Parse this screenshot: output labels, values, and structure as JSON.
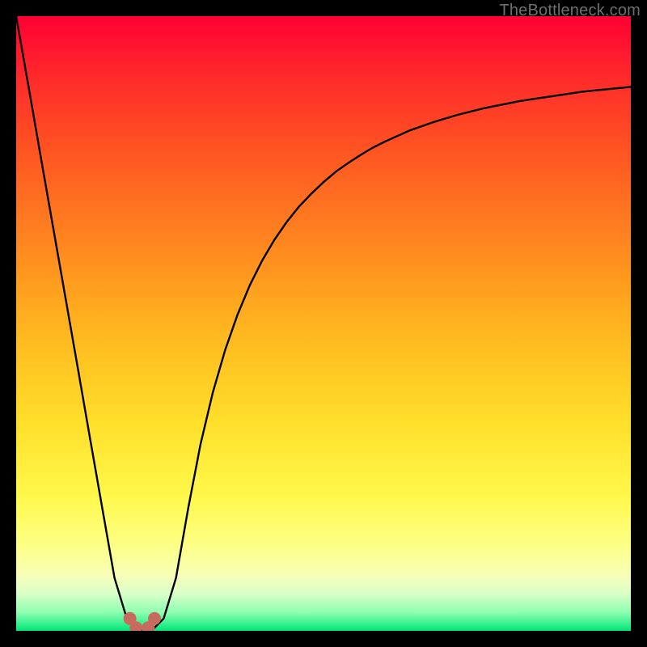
{
  "watermark": "TheBottleneck.com",
  "chart_data": {
    "type": "line",
    "title": "",
    "xlabel": "",
    "ylabel": "",
    "xlim": [
      0,
      100
    ],
    "ylim": [
      0,
      100
    ],
    "grid": false,
    "x": [
      0,
      2,
      4,
      6,
      8,
      10,
      12,
      14,
      16,
      18,
      20,
      22,
      24,
      26,
      28,
      30,
      32,
      34,
      36,
      38,
      40,
      42,
      44,
      46,
      48,
      50,
      52,
      54,
      56,
      58,
      60,
      62,
      64,
      66,
      68,
      70,
      72,
      74,
      76,
      78,
      80,
      82,
      84,
      86,
      88,
      90,
      92,
      94,
      96,
      98,
      100
    ],
    "series": [
      {
        "name": "bottleneck-curve",
        "values": [
          100,
          88.6,
          77.1,
          65.7,
          54.3,
          42.9,
          31.4,
          20,
          8.6,
          2,
          0,
          0,
          2,
          8.6,
          20,
          30.4,
          38.8,
          45.7,
          51.4,
          56.2,
          60.2,
          63.6,
          66.5,
          69,
          71.1,
          73,
          74.7,
          76.1,
          77.4,
          78.6,
          79.6,
          80.5,
          81.4,
          82.1,
          82.8,
          83.4,
          84,
          84.5,
          85,
          85.4,
          85.8,
          86.2,
          86.5,
          86.8,
          87.1,
          87.4,
          87.7,
          87.9,
          88.1,
          88.3,
          88.5
        ]
      }
    ],
    "markers": [
      {
        "name": "min-point-a",
        "x": 18.5,
        "y": 2
      },
      {
        "name": "min-point-b",
        "x": 22.5,
        "y": 2
      },
      {
        "name": "min-bridge-left",
        "x": 19.5,
        "y": 0.5
      },
      {
        "name": "min-bridge-right",
        "x": 21.5,
        "y": 0.5
      }
    ],
    "colors": {
      "curve": "#000000",
      "marker_fill": "#c96a5f",
      "gradient_top": "#ff0033",
      "gradient_bottom": "#00e678"
    }
  }
}
